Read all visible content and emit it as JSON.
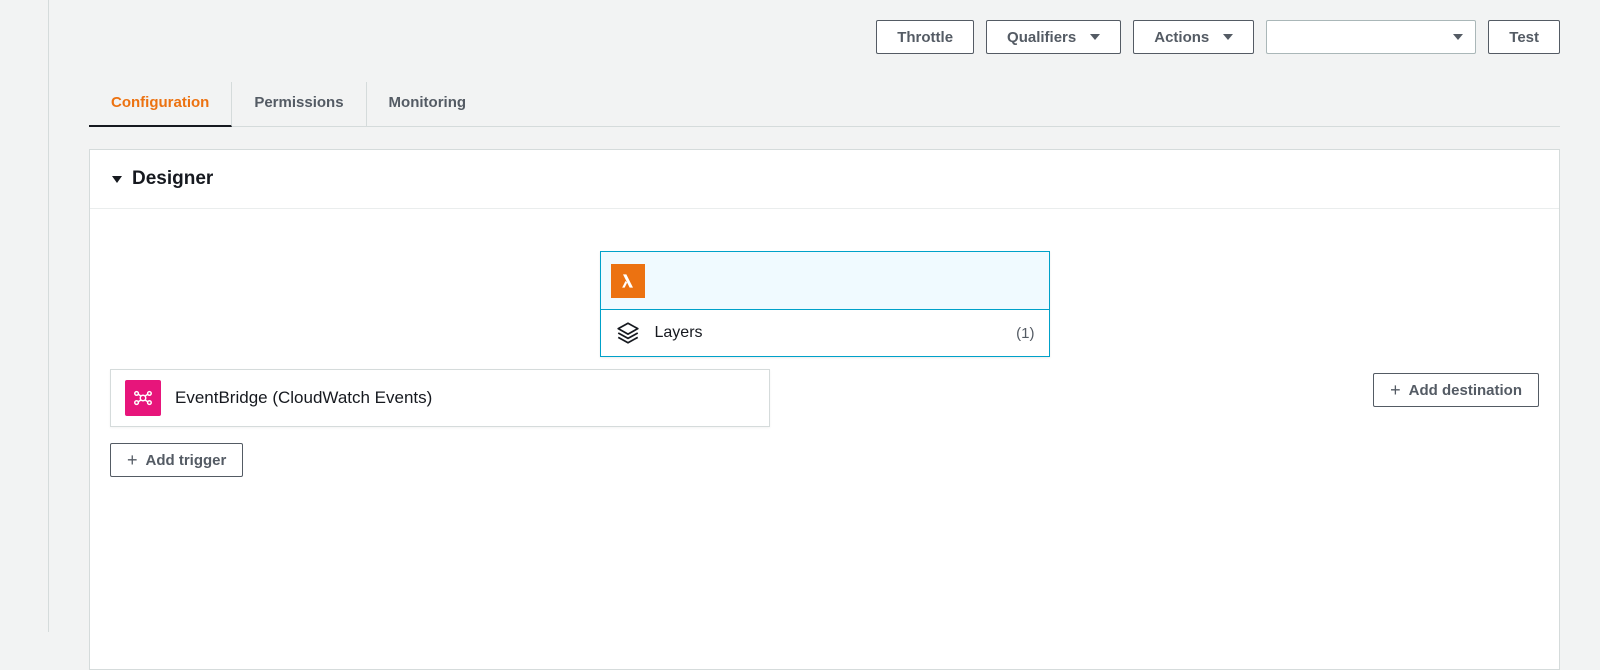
{
  "toolbar": {
    "throttle_label": "Throttle",
    "qualifiers_label": "Qualifiers",
    "actions_label": "Actions",
    "test_label": "Test"
  },
  "tabs": {
    "configuration": "Configuration",
    "permissions": "Permissions",
    "monitoring": "Monitoring"
  },
  "designer": {
    "title": "Designer",
    "layers_label": "Layers",
    "layers_count": "(1)",
    "trigger_label": "EventBridge (CloudWatch Events)",
    "add_trigger_label": "Add trigger",
    "add_destination_label": "Add destination"
  }
}
